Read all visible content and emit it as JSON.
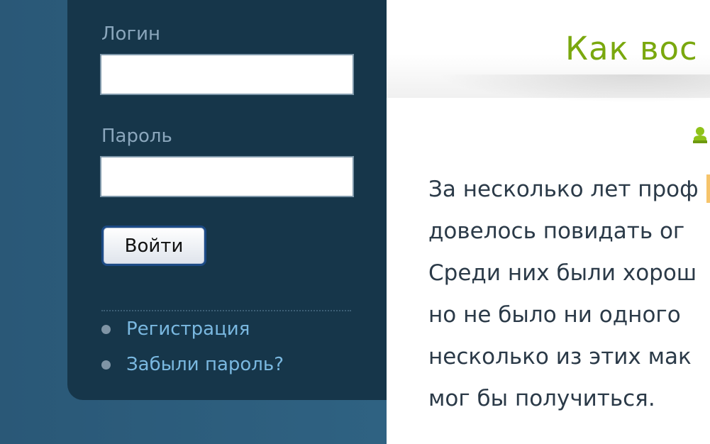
{
  "login": {
    "login_label": "Логин",
    "login_value": "",
    "password_label": "Пароль",
    "password_value": "",
    "submit_label": "Войти",
    "links": [
      {
        "label": "Регистрация"
      },
      {
        "label": "Забыли пароль?"
      }
    ]
  },
  "article": {
    "title": "Как вос",
    "author_icon": "user-icon",
    "lines": [
      "За несколько лет проф",
      "довелось повидать ог",
      "Среди них были хорош",
      "но не было ни одного",
      "несколько из этих мак",
      "мог бы получиться."
    ]
  },
  "colors": {
    "title_green": "#7aa80e",
    "panel_bg": "#16364a",
    "link_blue": "#7ab8e0",
    "page_bg": "#2b5a78"
  }
}
